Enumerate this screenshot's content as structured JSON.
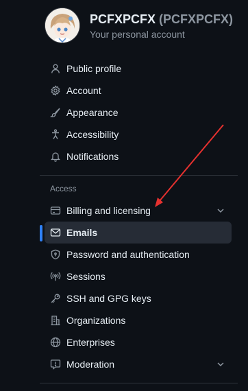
{
  "header": {
    "username": "PCFXPCFX",
    "username_paren": "(PCFXPCFX)",
    "subtitle": "Your personal account"
  },
  "nav": {
    "group1": [
      {
        "label": "Public profile",
        "icon": "person-icon"
      },
      {
        "label": "Account",
        "icon": "gear-icon"
      },
      {
        "label": "Appearance",
        "icon": "paintbrush-icon"
      },
      {
        "label": "Accessibility",
        "icon": "accessibility-icon"
      },
      {
        "label": "Notifications",
        "icon": "bell-icon"
      }
    ],
    "access_heading": "Access",
    "group2": [
      {
        "label": "Billing and licensing",
        "icon": "credit-card-icon",
        "expandable": true
      },
      {
        "label": "Emails",
        "icon": "mail-icon",
        "active": true
      },
      {
        "label": "Password and authentication",
        "icon": "shield-lock-icon"
      },
      {
        "label": "Sessions",
        "icon": "broadcast-icon"
      },
      {
        "label": "SSH and GPG keys",
        "icon": "key-icon"
      },
      {
        "label": "Organizations",
        "icon": "organization-icon"
      },
      {
        "label": "Enterprises",
        "icon": "globe-icon"
      },
      {
        "label": "Moderation",
        "icon": "report-icon",
        "expandable": true
      }
    ]
  },
  "colors": {
    "background": "#0d1117",
    "text": "#e6edf3",
    "muted": "#8d96a0",
    "active_bg": "#262c36",
    "accent": "#2f81f7",
    "annotation_arrow": "#e5312f"
  }
}
